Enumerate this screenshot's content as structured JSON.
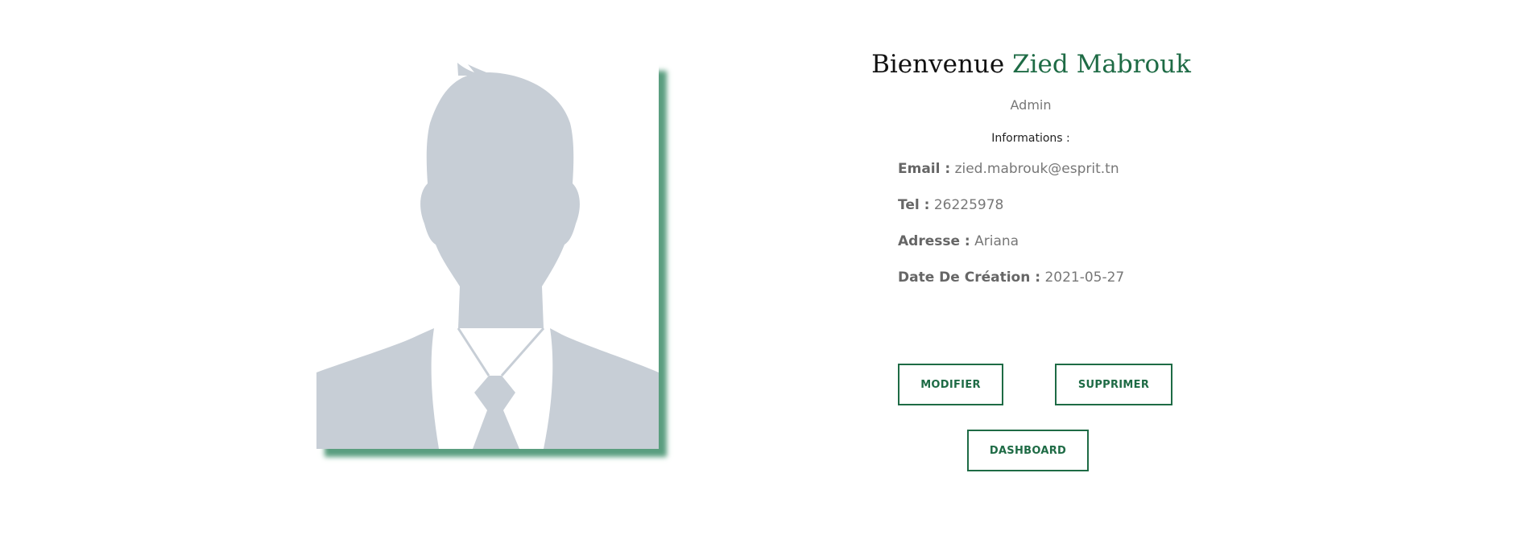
{
  "profile": {
    "welcome_prefix": "Bienvenue",
    "user_name": "Zied Mabrouk",
    "role": "Admin",
    "info_heading": "Informations :",
    "fields": {
      "email": {
        "label": "Email :",
        "value": "zied.mabrouk@esprit.tn"
      },
      "tel": {
        "label": "Tel :",
        "value": "26225978"
      },
      "adresse": {
        "label": "Adresse :",
        "value": "Ariana"
      },
      "date": {
        "label": "Date De Création :",
        "value": "2021-05-27"
      }
    }
  },
  "actions": {
    "modifier": "MODIFIER",
    "supprimer": "SUPPRIMER",
    "dashboard": "DASHBOARD"
  },
  "avatar": {
    "icon": "user-silhouette-icon",
    "silhouette_color": "#c7ced6",
    "shadow_color": "#5a9e7f"
  },
  "theme": {
    "accent": "#1e6b45",
    "muted_text": "#777777"
  }
}
